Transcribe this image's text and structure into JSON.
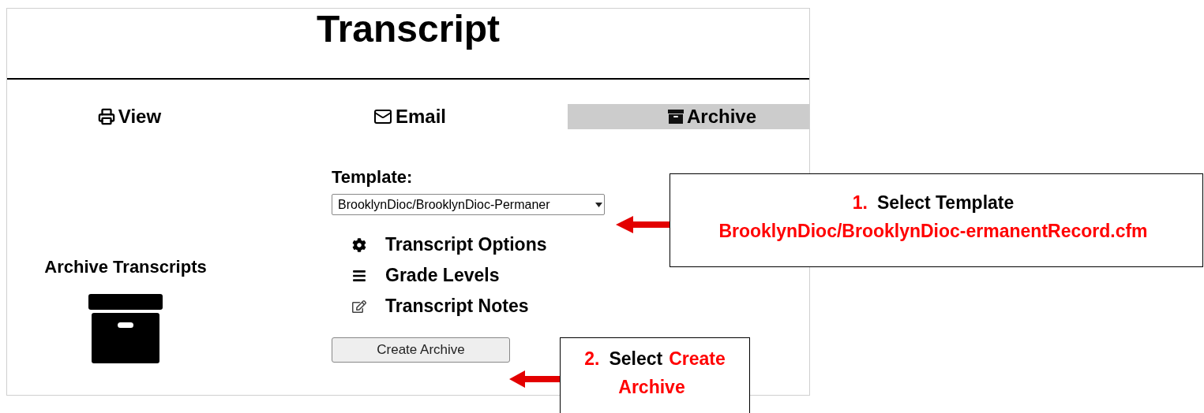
{
  "title": "Transcript",
  "tabs": [
    {
      "label": "View",
      "kind": "printer",
      "selected": false
    },
    {
      "label": "Email",
      "kind": "mail",
      "selected": false
    },
    {
      "label": "Archive",
      "kind": "archive",
      "selected": true
    }
  ],
  "archive_panel": {
    "heading": "Archive Transcripts"
  },
  "template": {
    "label": "Template:",
    "value": "BrooklynDioc/BrooklynDioc-Permaner"
  },
  "options": [
    {
      "label": "Transcript Options",
      "kind": "gear"
    },
    {
      "label": "Grade Levels",
      "kind": "bars"
    },
    {
      "label": "Transcript Notes",
      "kind": "edit"
    }
  ],
  "create_button": "Create Archive",
  "callouts": [
    {
      "lines": [
        [
          {
            "kind": "number",
            "text": "1."
          },
          {
            "kind": "plain",
            "text": "Select Template"
          }
        ],
        [
          {
            "kind": "highlight",
            "text": "BrooklynDioc/BrooklynDioc-ermanentRecord.cfm"
          }
        ]
      ]
    },
    {
      "lines": [
        [
          {
            "kind": "number",
            "text": "2."
          },
          {
            "kind": "plain",
            "text": "Select"
          },
          {
            "kind": "highlight",
            "text": "Create Archive"
          }
        ]
      ]
    }
  ]
}
